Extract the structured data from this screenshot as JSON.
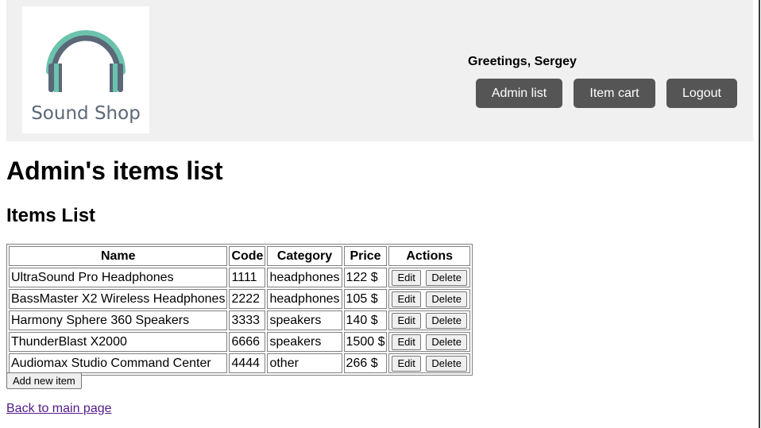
{
  "header": {
    "logo_text": "Sound Shop",
    "greeting": "Greetings, Sergey",
    "nav": {
      "admin_list": "Admin list",
      "item_cart": "Item cart",
      "logout": "Logout"
    },
    "colors": {
      "header_bg": "#f0f0f0",
      "nav_button_bg": "#555555",
      "logo_accent": "#6cc3ad",
      "logo_dark": "#5a6878"
    }
  },
  "main": {
    "title": "Admin's items list",
    "section_title": "Items List",
    "table": {
      "columns": [
        "Name",
        "Code",
        "Category",
        "Price",
        "Actions"
      ],
      "rows": [
        {
          "name": "UltraSound Pro Headphones",
          "code": "1111",
          "category": "headphones",
          "price": "122 $"
        },
        {
          "name": "BassMaster X2 Wireless Headphones",
          "code": "2222",
          "category": "headphones",
          "price": "105 $"
        },
        {
          "name": "Harmony Sphere 360 Speakers",
          "code": "3333",
          "category": "speakers",
          "price": "140 $"
        },
        {
          "name": "ThunderBlast X2000",
          "code": "6666",
          "category": "speakers",
          "price": "1500 $"
        },
        {
          "name": "Audiomax Studio Command Center",
          "code": "4444",
          "category": "other",
          "price": "266 $"
        }
      ],
      "edit_label": "Edit",
      "delete_label": "Delete"
    },
    "add_button": "Add new item",
    "back_link": "Back to main page"
  }
}
